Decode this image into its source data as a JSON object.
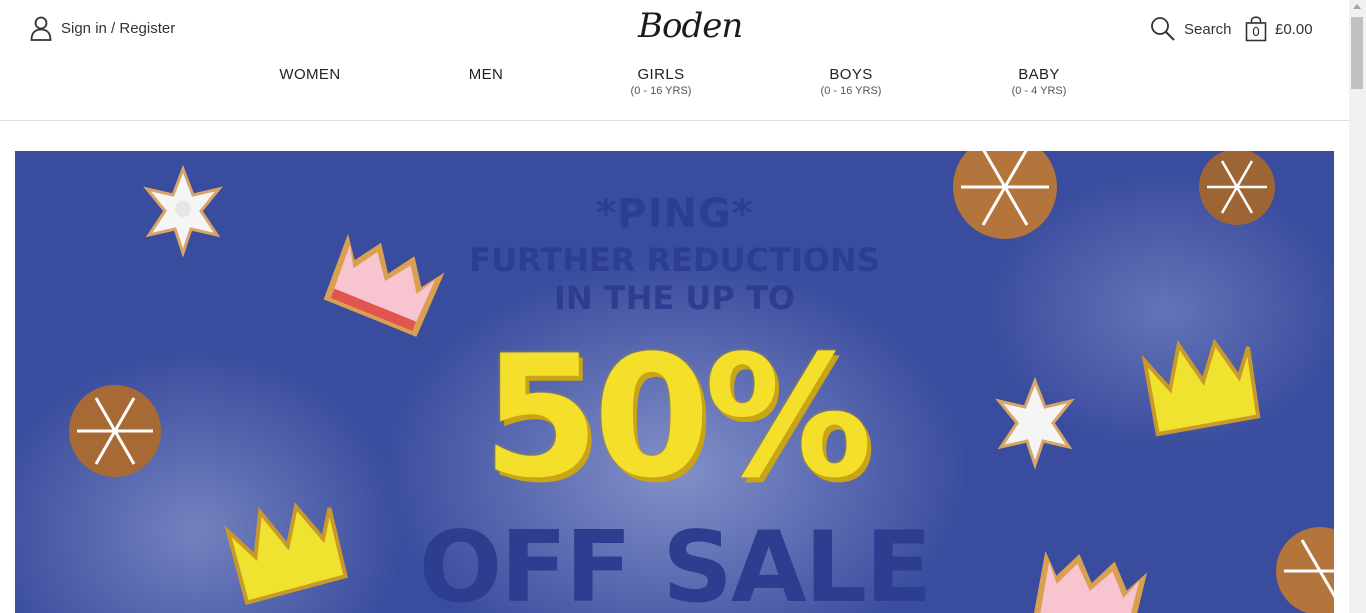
{
  "header": {
    "signin_label": "Sign in / Register",
    "logo_text": "Boden",
    "search_label": "Search",
    "bag_count": "0",
    "bag_total": "£0.00"
  },
  "nav": [
    {
      "label": "WOMEN",
      "sub": ""
    },
    {
      "label": "MEN",
      "sub": ""
    },
    {
      "label": "GIRLS",
      "sub": "(0 - 16 YRS)"
    },
    {
      "label": "BOYS",
      "sub": "(0 - 16 YRS)"
    },
    {
      "label": "BABY",
      "sub": "(0 - 4 YRS)"
    }
  ],
  "banner": {
    "line1": "*PING*",
    "line2": "FURTHER REDUCTIONS",
    "line3": "IN THE UP TO",
    "percent": "50%",
    "line5": "OFF SALE",
    "colors": {
      "background": "#3a4c9e",
      "headline": "#2d3e91",
      "percent": "#f4e02a"
    }
  },
  "icons": [
    "user-icon",
    "search-icon",
    "bag-icon"
  ]
}
